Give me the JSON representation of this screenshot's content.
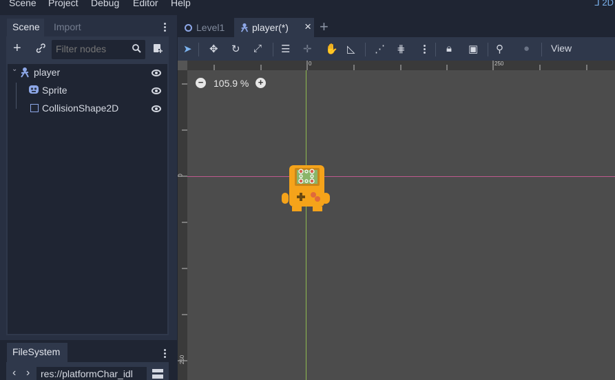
{
  "menu": {
    "items": [
      "Scene",
      "Project",
      "Debug",
      "Editor",
      "Help"
    ],
    "mode_label": "2D"
  },
  "left_dock": {
    "tabs": [
      {
        "label": "Scene",
        "active": true
      },
      {
        "label": "Import",
        "active": false
      }
    ],
    "filter_placeholder": "Filter nodes",
    "tree": [
      {
        "label": "player",
        "icon": "kinematic-body-icon",
        "selected": false
      },
      {
        "label": "Sprite",
        "icon": "sprite-icon",
        "selected": false
      },
      {
        "label": "CollisionShape2D",
        "icon": "collision-shape-icon",
        "selected": true
      }
    ]
  },
  "filesystem": {
    "tab_label": "FileSystem",
    "path": "res://platformChar_idl"
  },
  "editor_tabs": [
    {
      "label": "Level1",
      "active": false
    },
    {
      "label": "player(*)",
      "active": true
    }
  ],
  "toolbar2d": {
    "view_label": "View"
  },
  "viewport": {
    "zoom": "105.9 %",
    "ruler_top_labels": [
      "0",
      "250"
    ],
    "ruler_left_labels": [
      "0",
      "250"
    ],
    "colors": {
      "background": "#4c4c4c",
      "y_axis": "#8fbc4f",
      "x_axis": "#c05a8f",
      "sprite_body": "#f5a31a",
      "sprite_screen": "#8ab56a"
    }
  }
}
